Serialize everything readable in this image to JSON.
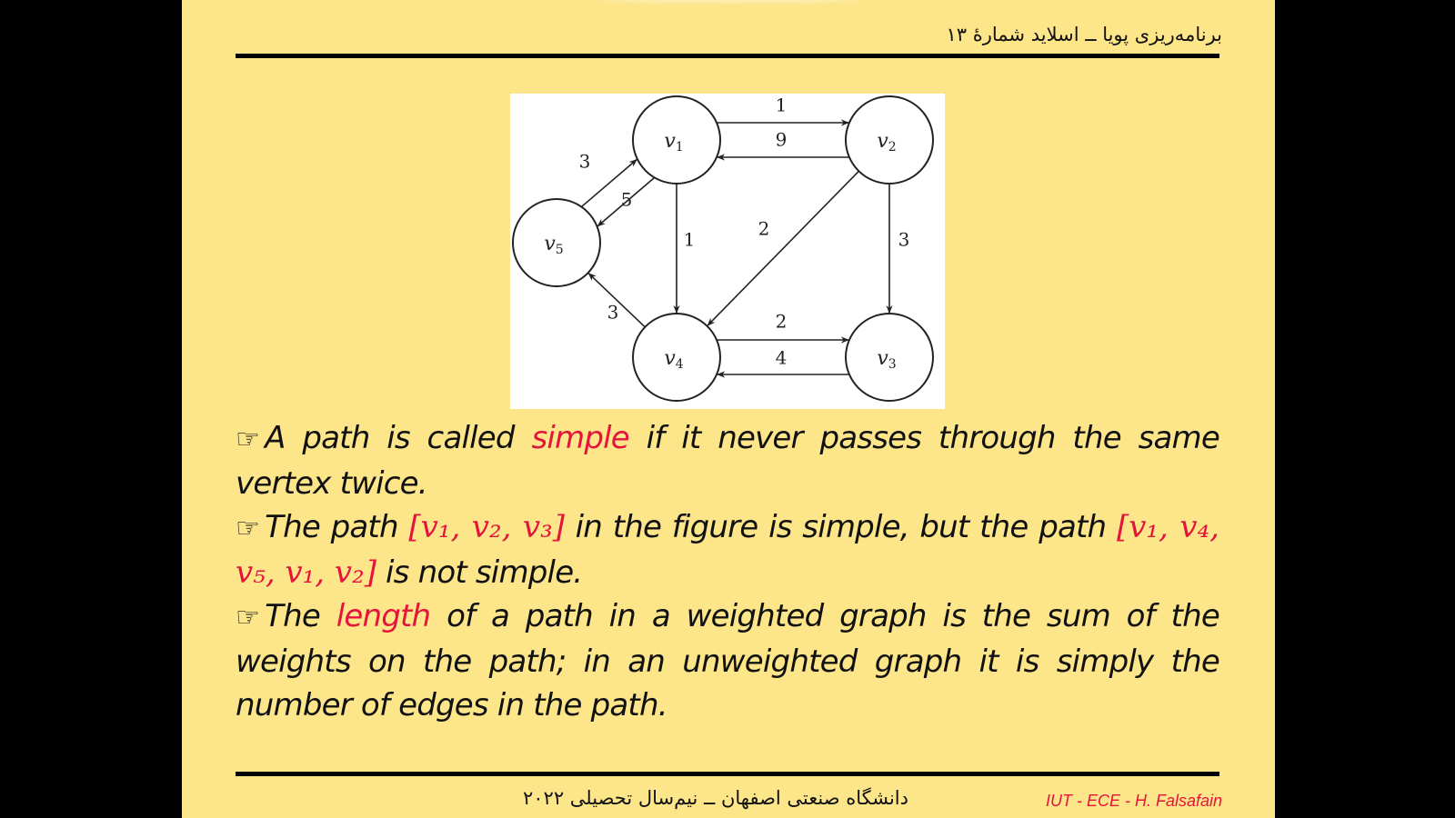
{
  "header": {
    "title": "برنامه‌ریزی پویا ــ اسلاید شمارهٔ ۱۳"
  },
  "graph": {
    "nodes": [
      {
        "id": "v1",
        "base": "v",
        "sub": "1"
      },
      {
        "id": "v2",
        "base": "v",
        "sub": "2"
      },
      {
        "id": "v3",
        "base": "v",
        "sub": "3"
      },
      {
        "id": "v4",
        "base": "v",
        "sub": "4"
      },
      {
        "id": "v5",
        "base": "v",
        "sub": "5"
      }
    ],
    "edges": [
      {
        "from": "v1",
        "to": "v2",
        "weight": "1"
      },
      {
        "from": "v2",
        "to": "v1",
        "weight": "9"
      },
      {
        "from": "v5",
        "to": "v1",
        "weight": "3"
      },
      {
        "from": "v1",
        "to": "v5",
        "weight": "5"
      },
      {
        "from": "v1",
        "to": "v4",
        "weight": "1"
      },
      {
        "from": "v2",
        "to": "v4",
        "weight": "2"
      },
      {
        "from": "v2",
        "to": "v3",
        "weight": "3"
      },
      {
        "from": "v4",
        "to": "v5",
        "weight": "3"
      },
      {
        "from": "v4",
        "to": "v3",
        "weight": "2"
      },
      {
        "from": "v3",
        "to": "v4",
        "weight": "4"
      }
    ]
  },
  "content": {
    "bullet_icon": "pointing-hand-icon",
    "bullet_glyph": "☞",
    "p1": {
      "a": "A path is called ",
      "highlight": "simple",
      "b": " if it never passes through the same vertex twice."
    },
    "p2": {
      "a": "The path ",
      "math1": "[v₁, v₂, v₃]",
      "b": " in the figure is simple, but the path ",
      "math2": "[v₁, v₄, v₅, v₁, v₂]",
      "c": " is not simple."
    },
    "p3": {
      "a": "The ",
      "highlight": "length",
      "b": " of a path in a weighted graph is the sum of the weights on the path; in an unweighted graph it is simply the number of edges in the path."
    }
  },
  "footer": {
    "center": "دانشگاه صنعتی اصفهان ــ نیم‌سال تحصیلی ۲۰۲۲",
    "right": "IUT - ECE - H. Falsafain"
  },
  "colors": {
    "slide_bg": "#fde58a",
    "accent": "#e5143d",
    "text": "#111111"
  }
}
